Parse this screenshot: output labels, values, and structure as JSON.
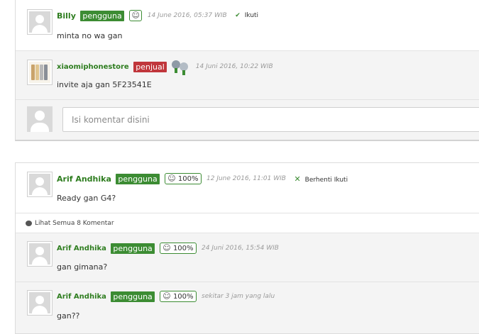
{
  "thread1": {
    "comments": [
      {
        "username": "Billy",
        "badge": "pengguna",
        "rating_icon": "smiley-icon",
        "rating_glyph": "☺",
        "time": "14 June 2016, 05:37 WIB",
        "action_icon": "check-icon",
        "action_glyph": "✔",
        "action_label": "Ikuti",
        "text": "minta no wa gan"
      },
      {
        "username": "xiaomiphonestore",
        "badge": "penjual",
        "time": "14 Juni 2016, 10:22 WIB",
        "text": "invite aja gan 5F23541E"
      }
    ],
    "input_placeholder": "Isi komentar disini"
  },
  "thread2": {
    "main": {
      "username": "Arif Andhika",
      "badge": "pengguna",
      "rating_glyph": "☺",
      "rating": "100%",
      "time": "12 June 2016, 11:01 WIB",
      "action_icon": "x-icon",
      "action_glyph": "✕",
      "action_label": "Berhenti Ikuti",
      "text": "Ready gan G4?"
    },
    "view_all": "Lihat Semua 8 Komentar",
    "replies": [
      {
        "username": "Arif Andhika",
        "badge": "pengguna",
        "rating_glyph": "☺",
        "rating": "100%",
        "time": "24 Juni 2016, 15:54 WIB",
        "text": "gan gimana?"
      },
      {
        "username": "Arif Andhika",
        "badge": "pengguna",
        "rating_glyph": "☺",
        "rating": "100%",
        "time": "sekitar 3 jam yang lalu",
        "text": "gan??"
      }
    ]
  },
  "colors": {
    "username": "#2e7d1f",
    "badge_green": "#3c8c33",
    "badge_red": "#c0363b",
    "reply_bg": "#f4f4f4"
  }
}
